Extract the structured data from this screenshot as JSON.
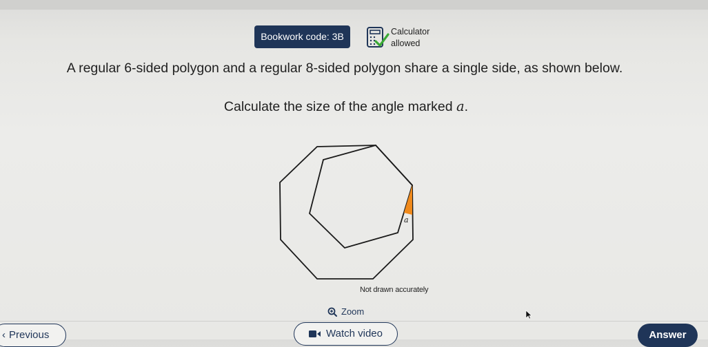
{
  "header": {
    "bookwork_code": "Bookwork code: 3B",
    "calculator_line1": "Calculator",
    "calculator_line2": "allowed"
  },
  "question": {
    "line1": "A regular 6-sided polygon and a regular 8-sided polygon share a single side, as shown below.",
    "line2_prefix": "Calculate the size of the angle marked ",
    "line2_var": "a",
    "line2_suffix": "."
  },
  "diagram": {
    "angle_label": "a",
    "note": "Not drawn accurately",
    "colors": {
      "angle_fill": "#f08a1c",
      "stroke": "#1a1a1a"
    }
  },
  "controls": {
    "zoom_label": "Zoom",
    "previous_label": "Previous",
    "watch_label": "Watch video",
    "answer_label": "Answer"
  },
  "colors": {
    "brand_navy": "#1f3558",
    "calc_green": "#3aa935"
  }
}
